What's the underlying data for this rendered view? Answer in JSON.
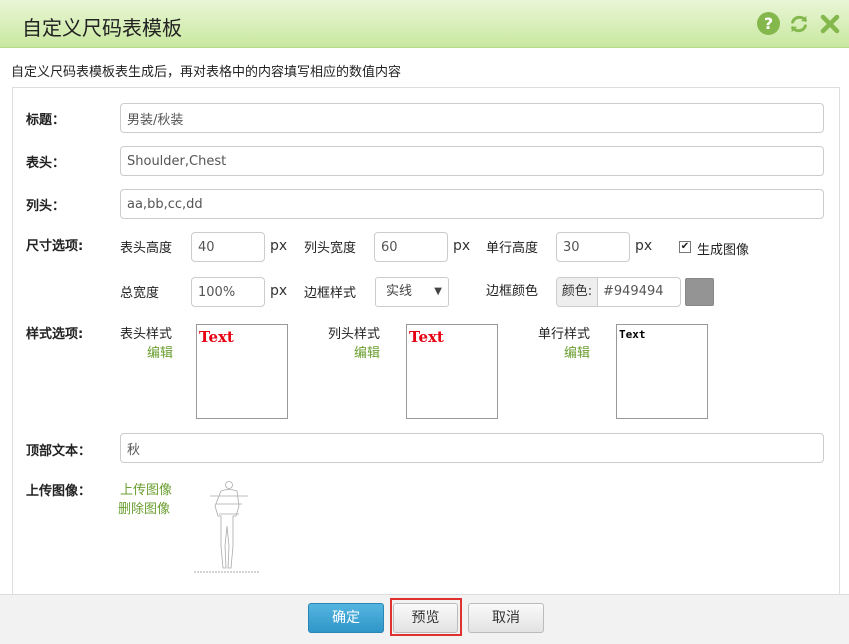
{
  "dialog": {
    "title": "自定义尺码表模板",
    "description": "自定义尺码表模板表生成后，再对表格中的内容填写相应的数值内容"
  },
  "colors": {
    "accent": "#6a9e2f",
    "border_color": "#949494",
    "highlight": "#e03131",
    "primary_button": "#2f96c8"
  },
  "form": {
    "title": {
      "label": "标题：",
      "value": "男装/秋装"
    },
    "header": {
      "label": "表头：",
      "value": "Shoulder,Chest"
    },
    "column_header": {
      "label": "列头：",
      "value": "aa,bb,cc,dd"
    },
    "size_options": {
      "label": "尺寸选项:",
      "header_height": {
        "label": "表头高度",
        "value": "40",
        "unit": "px"
      },
      "column_width": {
        "label": "列头宽度",
        "value": "60",
        "unit": "px"
      },
      "row_height": {
        "label": "单行高度",
        "value": "30",
        "unit": "px"
      },
      "generate_image": {
        "label": "生成图像",
        "checked": true
      },
      "total_width": {
        "label": "总宽度",
        "value": "100%",
        "unit": "px"
      },
      "border_style": {
        "label": "边框样式",
        "value": "实线"
      },
      "border_color": {
        "label": "边框颜色",
        "addon": "颜色:",
        "value": "#949494"
      }
    },
    "style_options": {
      "label": "样式选项:",
      "header_style": {
        "label": "表头样式",
        "edit": "编辑",
        "preview": "Text"
      },
      "column_style": {
        "label": "列头样式",
        "edit": "编辑",
        "preview": "Text"
      },
      "row_style": {
        "label": "单行样式",
        "edit": "编辑",
        "preview": "Text"
      }
    },
    "top_text": {
      "label": "顶部文本：",
      "value": "秋"
    },
    "upload_image": {
      "label": "上传图像：",
      "upload": "上传图像",
      "delete": "删除图像"
    }
  },
  "buttons": {
    "confirm": "确定",
    "preview": "预览",
    "cancel": "取消"
  }
}
